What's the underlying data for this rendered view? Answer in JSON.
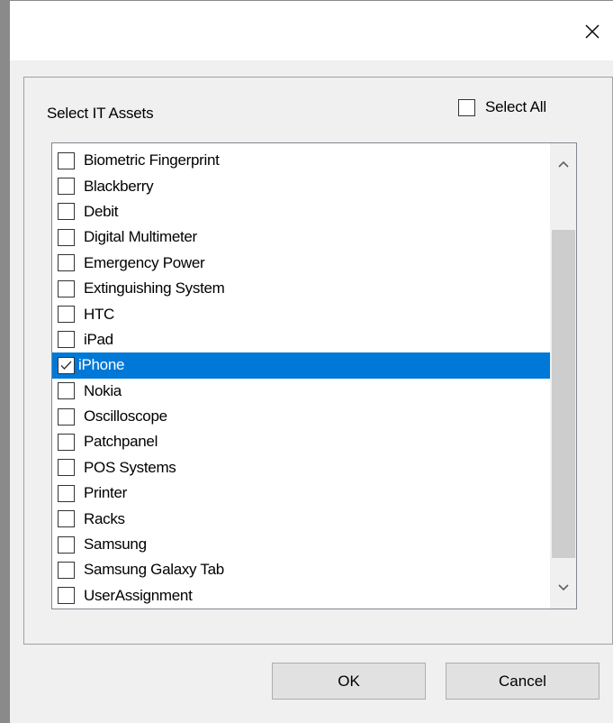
{
  "window": {
    "close_label": "×"
  },
  "dialog": {
    "heading": "Select IT Assets",
    "select_all": {
      "label": "Select All",
      "checked": false
    }
  },
  "list": {
    "items": [
      {
        "label": "Biometric Fingerprint",
        "checked": false,
        "selected": false
      },
      {
        "label": "Blackberry",
        "checked": false,
        "selected": false
      },
      {
        "label": "Debit",
        "checked": false,
        "selected": false
      },
      {
        "label": "Digital Multimeter",
        "checked": false,
        "selected": false
      },
      {
        "label": "Emergency Power",
        "checked": false,
        "selected": false
      },
      {
        "label": "Extinguishing System",
        "checked": false,
        "selected": false
      },
      {
        "label": "HTC",
        "checked": false,
        "selected": false
      },
      {
        "label": "iPad",
        "checked": false,
        "selected": false
      },
      {
        "label": "iPhone",
        "checked": true,
        "selected": true
      },
      {
        "label": "Nokia",
        "checked": false,
        "selected": false
      },
      {
        "label": "Oscilloscope",
        "checked": false,
        "selected": false
      },
      {
        "label": "Patchpanel",
        "checked": false,
        "selected": false
      },
      {
        "label": "POS Systems",
        "checked": false,
        "selected": false
      },
      {
        "label": "Printer",
        "checked": false,
        "selected": false
      },
      {
        "label": "Racks",
        "checked": false,
        "selected": false
      },
      {
        "label": "Samsung",
        "checked": false,
        "selected": false
      },
      {
        "label": "Samsung Galaxy Tab",
        "checked": false,
        "selected": false
      },
      {
        "label": "UserAssignment",
        "checked": false,
        "selected": false
      }
    ],
    "scroll_position": 0.5
  },
  "buttons": {
    "ok_label": "OK",
    "cancel_label": "Cancel"
  },
  "colors": {
    "selection": "#0078d7",
    "selection_text": "#ffffff",
    "dialog_bg": "#f0f0f0",
    "scroll_thumb": "#cdcdcd"
  },
  "icons": {
    "close": "close-icon",
    "scroll_up": "chevron-up-icon",
    "scroll_down": "chevron-down-icon",
    "check": "checkmark-icon"
  }
}
